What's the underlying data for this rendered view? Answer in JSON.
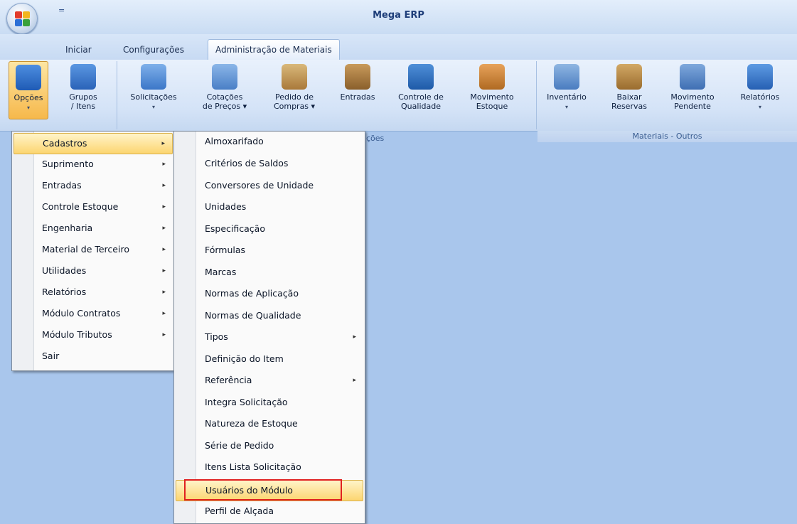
{
  "app": {
    "title": "Mega ERP",
    "qat_symbol": "="
  },
  "tabs": [
    {
      "label": "Iniciar"
    },
    {
      "label": "Configurações"
    },
    {
      "label": "Administração de Materiais",
      "active": true
    }
  ],
  "ribbon": {
    "buttons": {
      "opcoes": {
        "line1": "Opções",
        "line2": "▾"
      },
      "grupos": {
        "line1": "Grupos",
        "line2": "/ Itens"
      },
      "solicitacoes": {
        "line1": "Solicitações",
        "line2": "▾"
      },
      "cotacoes": {
        "line1": "Cotações",
        "line2": "de Preços ▾"
      },
      "pedido": {
        "line1": "Pedido de",
        "line2": "Compras ▾"
      },
      "entradas": {
        "line1": "Entradas",
        "line2": ""
      },
      "controle": {
        "line1": "Controle de",
        "line2": "Qualidade"
      },
      "movimento": {
        "line1": "Movimento",
        "line2": "Estoque"
      },
      "inventario": {
        "line1": "Inventário",
        "line2": "▾"
      },
      "baixar": {
        "line1": "Baixar",
        "line2": "Reservas"
      },
      "movpend": {
        "line1": "Movimento",
        "line2": "Pendente"
      },
      "relatorios": {
        "line1": "Relatórios",
        "line2": "▾"
      }
    },
    "group_labels": {
      "partial": "ções",
      "outros": "Materiais - Outros"
    }
  },
  "menu_main": [
    {
      "label": "Cadastros",
      "submenu": true,
      "highlighted": true
    },
    {
      "label": "Suprimento",
      "submenu": true
    },
    {
      "label": "Entradas",
      "submenu": true
    },
    {
      "label": "Controle Estoque",
      "submenu": true
    },
    {
      "label": "Engenharia",
      "submenu": true
    },
    {
      "label": "Material de Terceiro",
      "submenu": true
    },
    {
      "label": "Utilidades",
      "submenu": true
    },
    {
      "label": "Relatórios",
      "submenu": true
    },
    {
      "label": "Módulo Contratos",
      "submenu": true
    },
    {
      "label": "Módulo Tributos",
      "submenu": true
    },
    {
      "label": "Sair",
      "submenu": false
    }
  ],
  "menu_sub": [
    {
      "label": "Almoxarifado"
    },
    {
      "label": "Critérios de Saldos"
    },
    {
      "label": "Conversores de Unidade"
    },
    {
      "label": "Unidades"
    },
    {
      "label": "Especificação"
    },
    {
      "label": "Fórmulas"
    },
    {
      "label": "Marcas"
    },
    {
      "label": "Normas de Aplicação"
    },
    {
      "label": "Normas de Qualidade"
    },
    {
      "label": "Tipos",
      "submenu": true
    },
    {
      "label": "Definição do Item"
    },
    {
      "label": "Referência",
      "submenu": true
    },
    {
      "label": "Integra Solicitação"
    },
    {
      "label": "Natureza de Estoque"
    },
    {
      "label": "Série de Pedido"
    },
    {
      "label": "Itens Lista Solicitação"
    },
    {
      "label": "Usuários do Módulo",
      "highlighted": true
    },
    {
      "label": "Perfil de Alçada"
    }
  ],
  "submenu_arrow": "▸",
  "colors": {
    "accent_highlight": "#fcd570",
    "annotation_box": "#e02020",
    "workspace": "#a9c6ec"
  }
}
